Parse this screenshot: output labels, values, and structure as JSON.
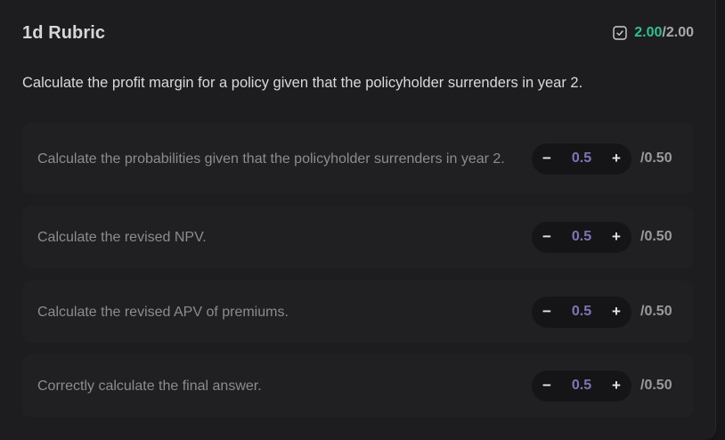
{
  "rubric": {
    "title": "1d Rubric",
    "score_got": "2.00",
    "score_sep": "/",
    "score_max": "2.00",
    "score_icon": "checkbox-checked-icon"
  },
  "question": "Calculate the profit margin for a policy given that the policyholder surrenders in year 2.",
  "items": [
    {
      "text": "Calculate the probabilities given that the policyholder surrenders in year 2.",
      "value": "0.5",
      "max": "/0.50",
      "minus": "−",
      "plus": "+"
    },
    {
      "text": "Calculate the revised NPV.",
      "value": "0.5",
      "max": "/0.50",
      "minus": "−",
      "plus": "+"
    },
    {
      "text": "Calculate the revised APV of premiums.",
      "value": "0.5",
      "max": "/0.50",
      "minus": "−",
      "plus": "+"
    },
    {
      "text": "Correctly calculate the final answer.",
      "value": "0.5",
      "max": "/0.50",
      "minus": "−",
      "plus": "+"
    }
  ],
  "colors": {
    "score_green": "#2fc08f",
    "value_purple": "#7d76b6",
    "panel_bg": "#1d1d1f",
    "item_bg": "#202022"
  }
}
